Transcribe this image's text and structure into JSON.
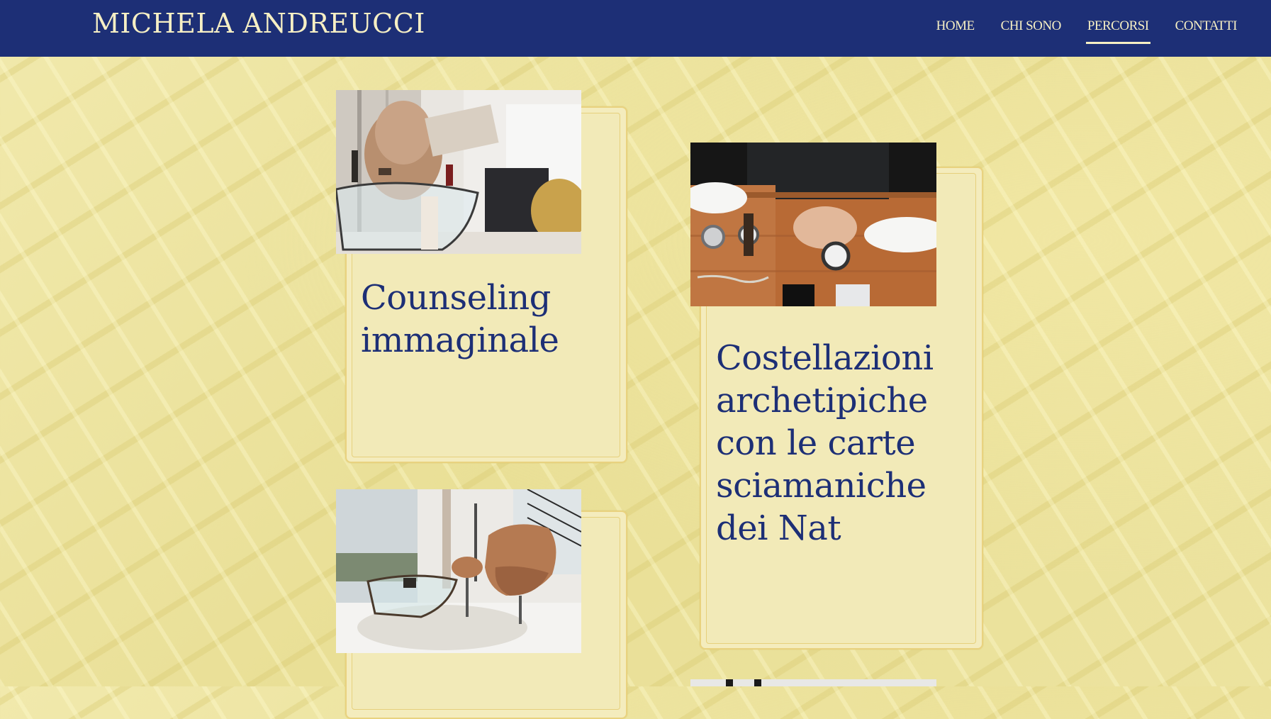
{
  "header": {
    "logo": "MICHELA ANDREUCCI",
    "nav": [
      {
        "label": "HOME",
        "active": false
      },
      {
        "label": "CHI SONO",
        "active": false
      },
      {
        "label": "PERCORSI",
        "active": true
      },
      {
        "label": "CONTATTI",
        "active": false
      }
    ]
  },
  "cards": [
    {
      "title": "Counseling immaginale",
      "photo": "living-room-reading-photo"
    },
    {
      "title": "Costellazioni archetipiche con le carte sciamaniche dei Nat",
      "photo": "desk-watches-photo"
    },
    {
      "photo": "lounge-chair-photo"
    }
  ],
  "colors": {
    "header_bg": "#1d2f76",
    "header_text": "#f6efc4",
    "page_bg": "#ece39f",
    "card_bg": "#f4ecbd",
    "card_border": "#e9d27f",
    "title_text": "#1d2f76"
  }
}
